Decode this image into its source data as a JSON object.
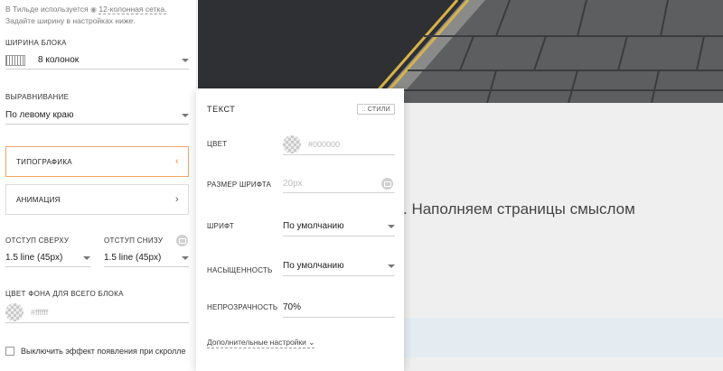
{
  "left_panel": {
    "hint": {
      "before": "В Тильде используется",
      "link": "12-колонная сетка.",
      "after": "Задайте ширину в настройках ниже."
    },
    "block_width": {
      "label": "ШИРИНА БЛОКА",
      "value": "8 колонок"
    },
    "alignment": {
      "label": "ВЫРАВНИВАНИЕ",
      "value": "По левому краю"
    },
    "typography": {
      "label": "ТИПОГРАФИКА",
      "state": "active"
    },
    "animation": {
      "label": "АНИМАЦИЯ"
    },
    "padding_top": {
      "label": "ОТСТУП СВЕРХУ",
      "value": "1.5 line (45px)"
    },
    "padding_bottom": {
      "label": "ОТСТУП СНИЗУ",
      "value": "1.5 line (45px)"
    },
    "bg_color": {
      "label": "ЦВЕТ ФОНА ДЛЯ ВСЕГО БЛОКА",
      "placeholder": "#ffffff"
    },
    "scroll_effect": {
      "label": "Выключить эффект появления при скролле",
      "checked": false
    }
  },
  "popup": {
    "title": "ТЕКСТ",
    "styles_button": "СТИЛИ",
    "color": {
      "label": "ЦВЕТ",
      "placeholder": "#000000"
    },
    "font_size": {
      "label": "РАЗМЕР ШРИФТА",
      "placeholder": "20px"
    },
    "font": {
      "label": "ШРИФТ",
      "value": "По умолчанию"
    },
    "weight": {
      "label": "НАСЫЩЕННОСТЬ",
      "value": "По умолчанию"
    },
    "opacity": {
      "label": "НЕПРОЗРАЧНОСТЬ",
      "value": "70%"
    },
    "more_settings": "Дополнительные настройки"
  },
  "preview": {
    "heading": ". Наполняем страницы смыслом"
  },
  "colors": {
    "accent_border": "#f3a563",
    "accent_chevron": "#f08a3a",
    "preview_bg": "#efefef",
    "band_bg": "#e4ecf2"
  }
}
